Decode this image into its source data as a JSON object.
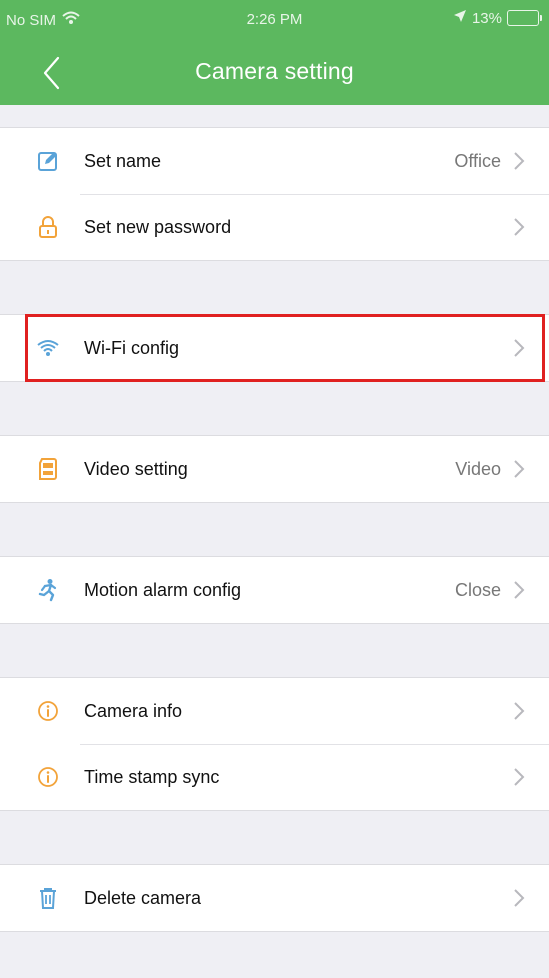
{
  "status_bar": {
    "carrier": "No SIM",
    "time": "2:26 PM",
    "battery": "13%",
    "battery_level": 0.13
  },
  "nav": {
    "back_icon": "chevron-left-icon",
    "title": "Camera setting"
  },
  "sections": [
    {
      "items": [
        {
          "label": "Set name",
          "value": "Office",
          "icon": "edit-icon"
        },
        {
          "label": "Set new password",
          "value": "",
          "icon": "lock-icon"
        }
      ]
    },
    {
      "items": [
        {
          "label": "Wi-Fi config",
          "value": "",
          "icon": "wifi-icon",
          "highlighted": true
        }
      ]
    },
    {
      "items": [
        {
          "label": "Video setting",
          "value": "Video",
          "icon": "sd-card-icon"
        }
      ]
    },
    {
      "items": [
        {
          "label": "Motion alarm config",
          "value": "Close",
          "icon": "running-person-icon"
        }
      ]
    },
    {
      "items": [
        {
          "label": "Camera info",
          "value": "",
          "icon": "info-icon"
        },
        {
          "label": "Time stamp sync",
          "value": "",
          "icon": "info-icon"
        }
      ]
    },
    {
      "items": [
        {
          "label": "Delete camera",
          "value": "",
          "icon": "trash-icon"
        }
      ]
    }
  ],
  "colors": {
    "header": "#5cb85f",
    "icon_blue": "#5aa3d8",
    "icon_orange": "#f2a33a",
    "highlight": "#e02020"
  }
}
